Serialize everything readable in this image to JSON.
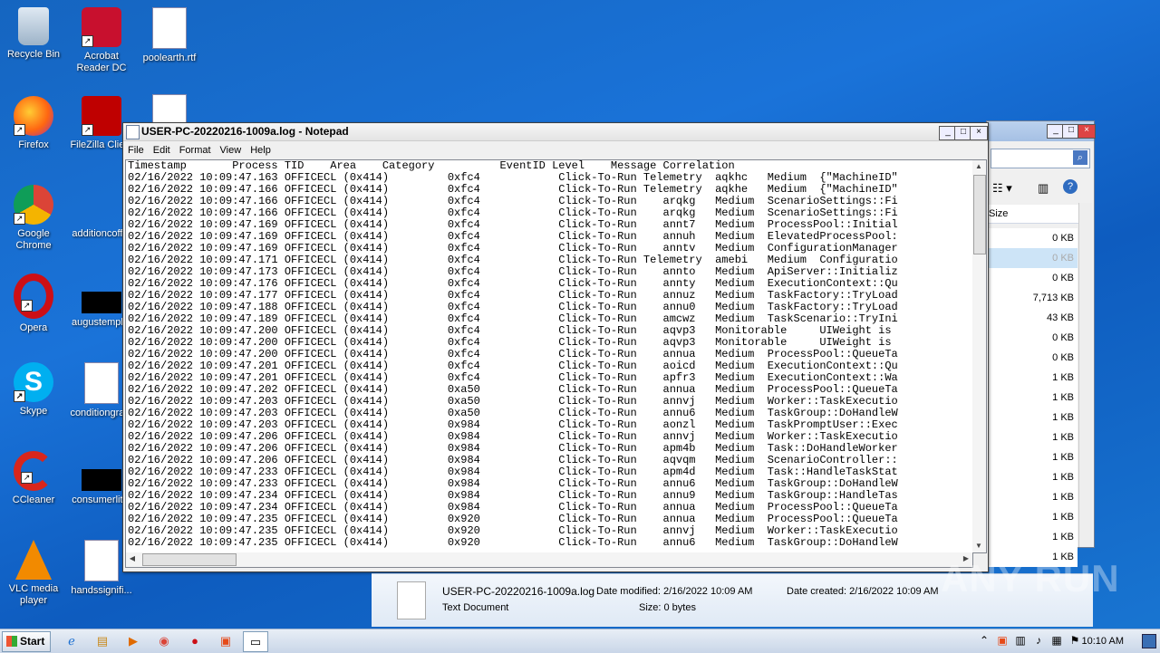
{
  "desktop_icons": [
    {
      "label": "Recycle Bin",
      "icon": "recycle-bin-icon"
    },
    {
      "label": "Acrobat Reader DC",
      "icon": "acrobat-icon"
    },
    {
      "label": "poolearth.rtf",
      "icon": "word-doc-icon"
    },
    {
      "label": "Firefox",
      "icon": "firefox-icon"
    },
    {
      "label": "FileZilla Clie...",
      "icon": "filezilla-icon"
    },
    {
      "label": "Google Chrome",
      "icon": "chrome-icon"
    },
    {
      "label": "additioncoff...",
      "icon": "file-icon"
    },
    {
      "label": "Opera",
      "icon": "opera-icon"
    },
    {
      "label": "augustempl...",
      "icon": "file-icon"
    },
    {
      "label": "Skype",
      "icon": "skype-icon"
    },
    {
      "label": "conditiongra...",
      "icon": "word-doc-icon"
    },
    {
      "label": "CCleaner",
      "icon": "ccleaner-icon"
    },
    {
      "label": "consumerlit...",
      "icon": "file-icon"
    },
    {
      "label": "VLC media player",
      "icon": "vlc-icon"
    },
    {
      "label": "handssignifi...",
      "icon": "word-doc-icon"
    }
  ],
  "notepad": {
    "title": "USER-PC-20220216-1009a.log - Notepad",
    "menu": [
      "File",
      "Edit",
      "Format",
      "View",
      "Help"
    ],
    "header_line": "Timestamp       Process TID    Area    Category          EventID Level    Message Correlation",
    "lines": [
      "02/16/2022 10:09:47.163 OFFICECL (0x414)         0xfc4            Click-To-Run Telemetry  aqkhc   Medium  {\"MachineID\"",
      "02/16/2022 10:09:47.166 OFFICECL (0x414)         0xfc4            Click-To-Run Telemetry  aqkhe   Medium  {\"MachineID\"",
      "02/16/2022 10:09:47.166 OFFICECL (0x414)         0xfc4            Click-To-Run    arqkg   Medium  ScenarioSettings::Fi",
      "02/16/2022 10:09:47.166 OFFICECL (0x414)         0xfc4            Click-To-Run    arqkg   Medium  ScenarioSettings::Fi",
      "02/16/2022 10:09:47.169 OFFICECL (0x414)         0xfc4            Click-To-Run    annt7   Medium  ProcessPool::Initial",
      "02/16/2022 10:09:47.169 OFFICECL (0x414)         0xfc4            Click-To-Run    annuh   Medium  ElevatedProcessPool:",
      "02/16/2022 10:09:47.169 OFFICECL (0x414)         0xfc4            Click-To-Run    anntv   Medium  ConfigurationManager",
      "02/16/2022 10:09:47.171 OFFICECL (0x414)         0xfc4            Click-To-Run Telemetry  amebi   Medium  Configuratio",
      "02/16/2022 10:09:47.173 OFFICECL (0x414)         0xfc4            Click-To-Run    annto   Medium  ApiServer::Initializ",
      "02/16/2022 10:09:47.176 OFFICECL (0x414)         0xfc4            Click-To-Run    annty   Medium  ExecutionContext::Qu",
      "02/16/2022 10:09:47.177 OFFICECL (0x414)         0xfc4            Click-To-Run    annuz   Medium  TaskFactory::TryLoad",
      "02/16/2022 10:09:47.188 OFFICECL (0x414)         0xfc4            Click-To-Run    annu0   Medium  TaskFactory::TryLoad",
      "02/16/2022 10:09:47.189 OFFICECL (0x414)         0xfc4            Click-To-Run    amcwz   Medium  TaskScenario::TryIni",
      "02/16/2022 10:09:47.200 OFFICECL (0x414)         0xfc4            Click-To-Run    aqvp3   Monitorable     UIWeight is",
      "02/16/2022 10:09:47.200 OFFICECL (0x414)         0xfc4            Click-To-Run    aqvp3   Monitorable     UIWeight is",
      "02/16/2022 10:09:47.200 OFFICECL (0x414)         0xfc4            Click-To-Run    annua   Medium  ProcessPool::QueueTa",
      "02/16/2022 10:09:47.201 OFFICECL (0x414)         0xfc4            Click-To-Run    aoicd   Medium  ExecutionContext::Qu",
      "02/16/2022 10:09:47.201 OFFICECL (0x414)         0xfc4            Click-To-Run    apfr3   Medium  ExecutionContext::Wa",
      "02/16/2022 10:09:47.202 OFFICECL (0x414)         0xa50            Click-To-Run    annua   Medium  ProcessPool::QueueTa",
      "02/16/2022 10:09:47.203 OFFICECL (0x414)         0xa50            Click-To-Run    annvj   Medium  Worker::TaskExecutio",
      "02/16/2022 10:09:47.203 OFFICECL (0x414)         0xa50            Click-To-Run    annu6   Medium  TaskGroup::DoHandleW",
      "02/16/2022 10:09:47.203 OFFICECL (0x414)         0x984            Click-To-Run    aonzl   Medium  TaskPromptUser::Exec",
      "02/16/2022 10:09:47.206 OFFICECL (0x414)         0x984            Click-To-Run    annvj   Medium  Worker::TaskExecutio",
      "02/16/2022 10:09:47.206 OFFICECL (0x414)         0x984            Click-To-Run    apm4b   Medium  Task::DoHandleWorker",
      "02/16/2022 10:09:47.206 OFFICECL (0x414)         0x984            Click-To-Run    aqvqm   Medium  ScenarioController::",
      "02/16/2022 10:09:47.233 OFFICECL (0x414)         0x984            Click-To-Run    apm4d   Medium  Task::HandleTaskStat",
      "02/16/2022 10:09:47.233 OFFICECL (0x414)         0x984            Click-To-Run    annu6   Medium  TaskGroup::DoHandleW",
      "02/16/2022 10:09:47.234 OFFICECL (0x414)         0x984            Click-To-Run    annu9   Medium  TaskGroup::HandleTas",
      "02/16/2022 10:09:47.234 OFFICECL (0x414)         0x984            Click-To-Run    annua   Medium  ProcessPool::QueueTa",
      "02/16/2022 10:09:47.235 OFFICECL (0x414)         0x920            Click-To-Run    annua   Medium  ProcessPool::QueueTa",
      "02/16/2022 10:09:47.235 OFFICECL (0x414)         0x920            Click-To-Run    annvj   Medium  Worker::TaskExecutio",
      "02/16/2022 10:09:47.235 OFFICECL (0x414)         0x920            Click-To-Run    annu6   Medium  TaskGroup::DoHandleW"
    ]
  },
  "explorer": {
    "column_header": "Size",
    "sizes": [
      "0 KB",
      "0 KB",
      "0 KB",
      "7,713 KB",
      "43 KB",
      "0 KB",
      "0 KB",
      "1 KB",
      "1 KB",
      "1 KB",
      "1 KB",
      "1 KB",
      "1 KB",
      "1 KB",
      "1 KB",
      "1 KB",
      "1 KB"
    ]
  },
  "details_pane": {
    "file_name": "USER-PC-20220216-1009a.log",
    "file_type": "Text Document",
    "date_modified": "Date modified: 2/16/2022 10:09 AM",
    "size": "Size: 0 bytes",
    "date_created": "Date created: 2/16/2022 10:09 AM"
  },
  "taskbar": {
    "start_label": "Start",
    "clock": "10:10 AM"
  },
  "watermark": "ANY RUN"
}
